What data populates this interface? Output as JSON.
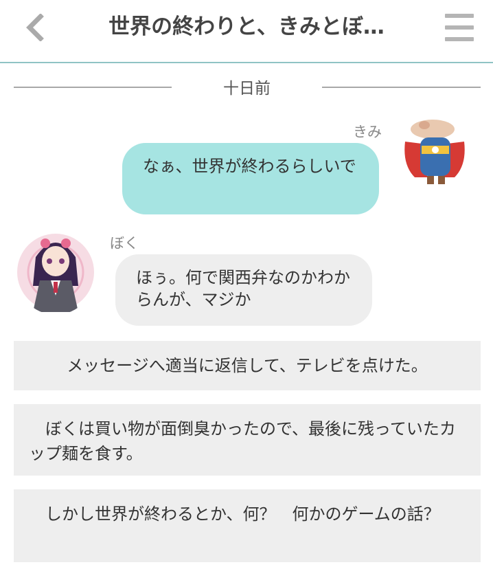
{
  "header": {
    "title": "世界の終わりと、きみとぼ…"
  },
  "date_separator": "十日前",
  "messages": [
    {
      "sender": "きみ",
      "text": "なぁ、世界が終わるらしいで"
    },
    {
      "sender": "ぼく",
      "text": "ほぅ。何で関西弁なのかわからんが、マジか"
    }
  ],
  "narration": [
    "メッセージへ適当に返信して、テレビを点けた。",
    "ぼくは買い物が面倒臭かったので、最後に残っていたカップ麺を食す。",
    "しかし世界が終わるとか、何？　何かのゲームの話？"
  ],
  "colors": {
    "accent_line": "#8fc3c4",
    "right_bubble": "#a6e4e2",
    "left_bubble": "#eeeeee",
    "narration_bg": "#eeeeee"
  },
  "icons": [
    "back-chevron-icon",
    "hamburger-menu-icon"
  ]
}
